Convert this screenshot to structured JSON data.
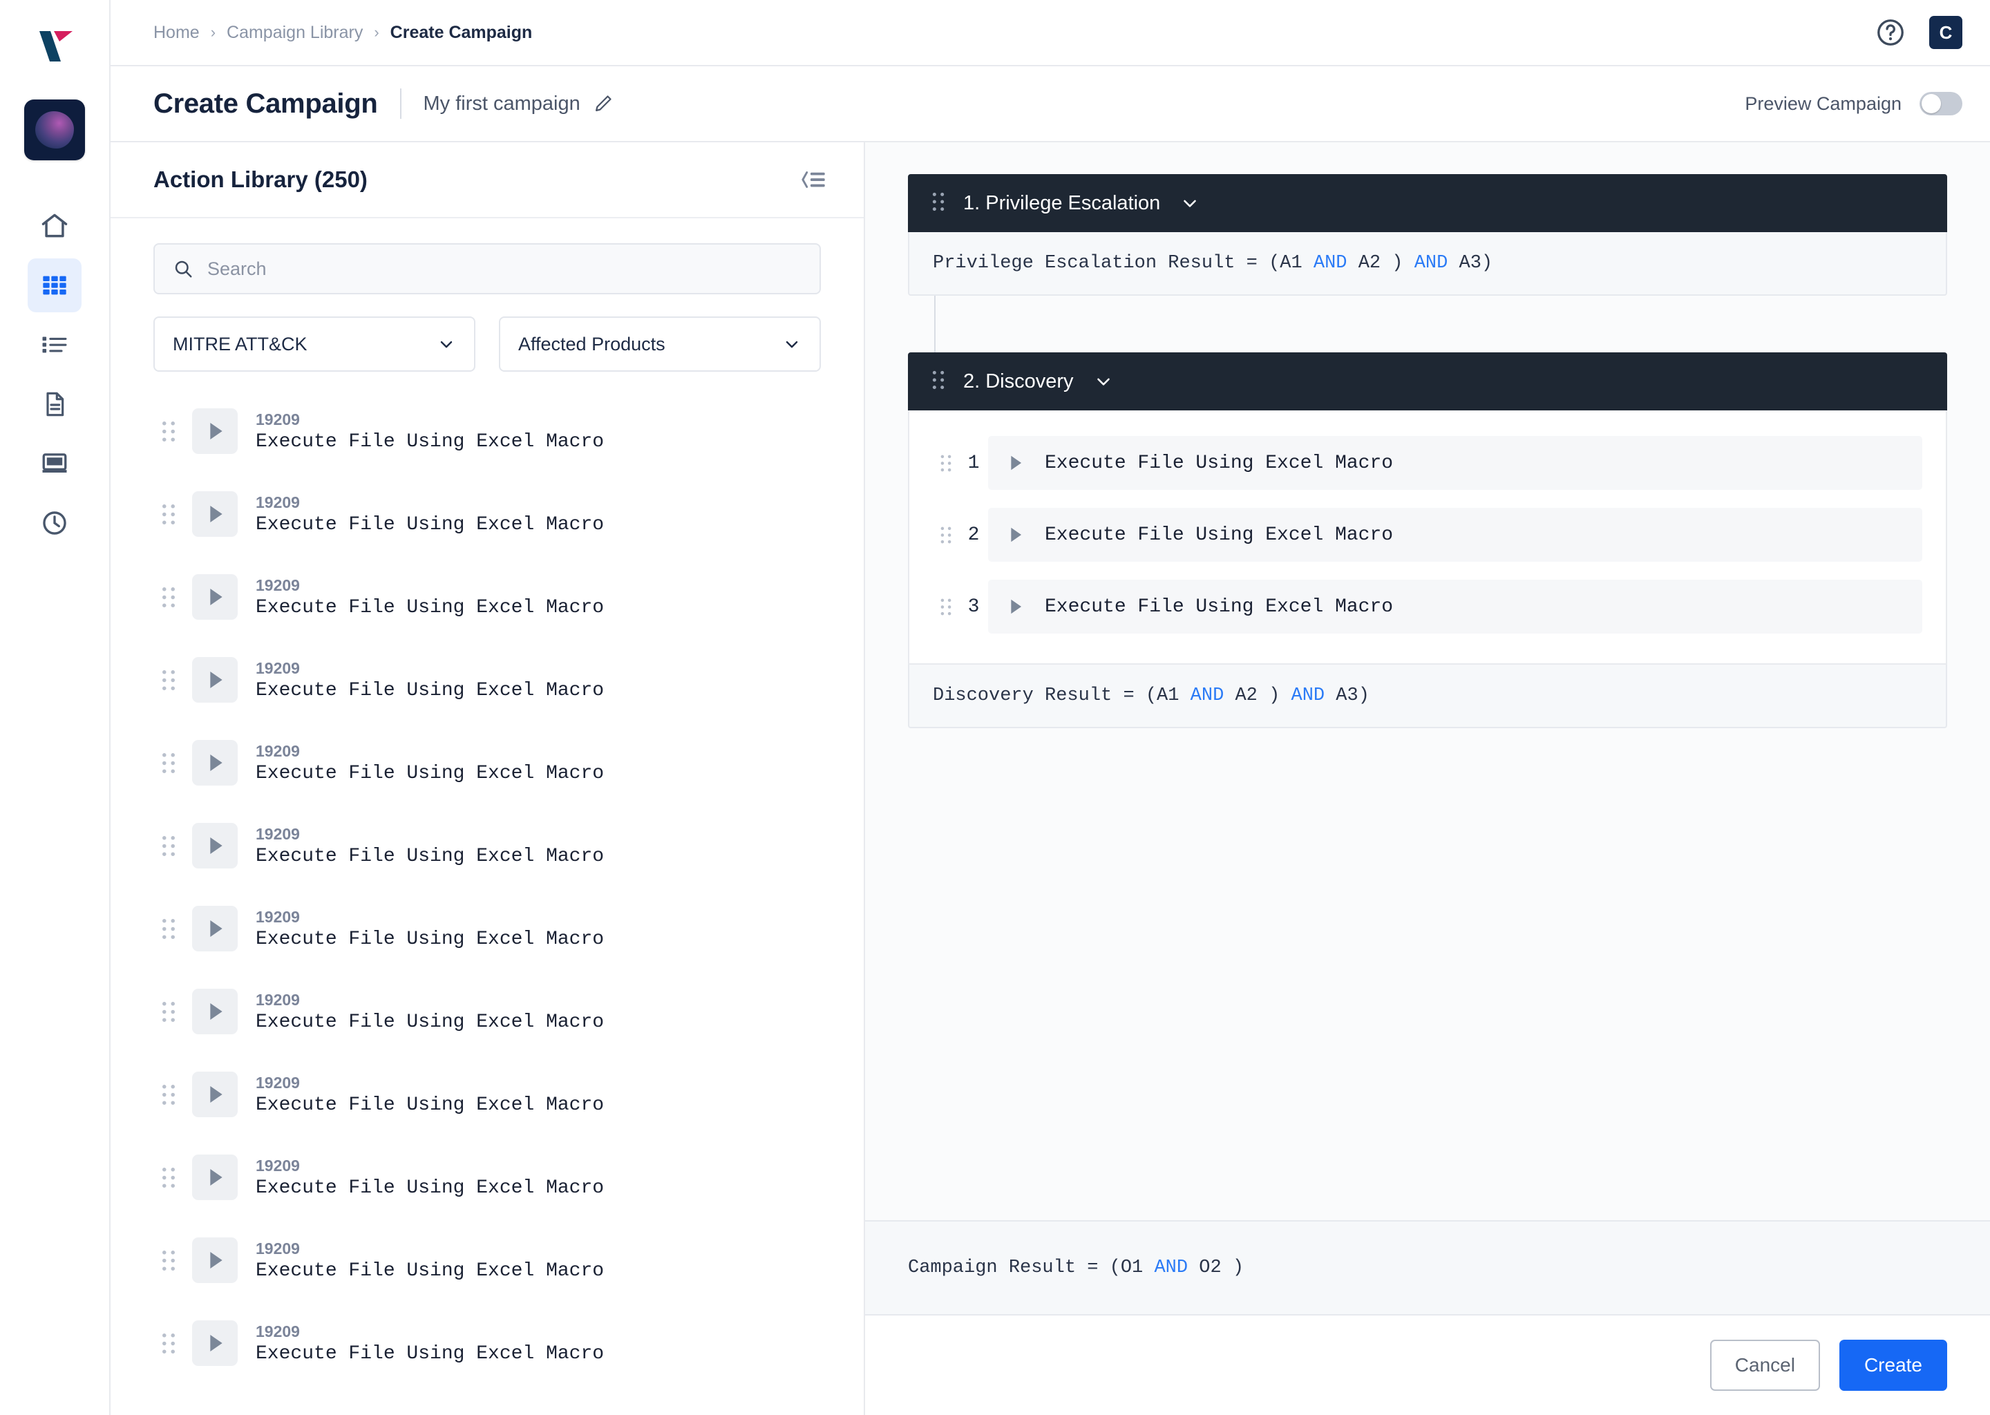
{
  "brand": {
    "logo_name": "valence-logo",
    "tile_icon": "orb-icon",
    "accent_blue": "#1668f5",
    "dark_navy": "#132a4e",
    "keyword_blue": "#2b7bf6",
    "phase_header_bg": "#1e2733"
  },
  "rail": {
    "items": [
      {
        "name": "home-icon",
        "label": "Home",
        "active": false
      },
      {
        "name": "grid-icon",
        "label": "Campaigns",
        "active": true
      },
      {
        "name": "list-icon",
        "label": "Actions",
        "active": false
      },
      {
        "name": "document-icon",
        "label": "Reports",
        "active": false
      },
      {
        "name": "monitor-icon",
        "label": "Agents",
        "active": false
      },
      {
        "name": "clock-icon",
        "label": "History",
        "active": false
      }
    ]
  },
  "breadcrumb": {
    "items": [
      {
        "label": "Home",
        "current": false
      },
      {
        "label": "Campaign Library",
        "current": false
      },
      {
        "label": "Create Campaign",
        "current": true
      }
    ],
    "separator": "›",
    "help_icon": "help-circle-icon",
    "avatar_initial": "C"
  },
  "title_bar": {
    "page_title": "Create Campaign",
    "campaign_name": "My first campaign",
    "edit_icon": "pencil-icon",
    "preview_label": "Preview Campaign",
    "preview_enabled": false
  },
  "library": {
    "heading": "Action Library (250)",
    "collapse_icon": "collapse-panel-icon",
    "search": {
      "value": "",
      "placeholder": "Search",
      "icon": "search-icon"
    },
    "filters": [
      {
        "label": "MITRE ATT&CK",
        "icon": "chevron-down-icon"
      },
      {
        "label": "Affected Products",
        "icon": "chevron-down-icon"
      }
    ],
    "items": [
      {
        "id": "19209",
        "name": "Execute File Using Excel Macro"
      },
      {
        "id": "19209",
        "name": "Execute File Using Excel Macro"
      },
      {
        "id": "19209",
        "name": "Execute File Using Excel Macro"
      },
      {
        "id": "19209",
        "name": "Execute File Using Excel Macro"
      },
      {
        "id": "19209",
        "name": "Execute File Using Excel Macro"
      },
      {
        "id": "19209",
        "name": "Execute File Using Excel Macro"
      },
      {
        "id": "19209",
        "name": "Execute File Using Excel Macro"
      },
      {
        "id": "19209",
        "name": "Execute File Using Excel Macro"
      },
      {
        "id": "19209",
        "name": "Execute File Using Excel Macro"
      },
      {
        "id": "19209",
        "name": "Execute File Using Excel Macro"
      },
      {
        "id": "19209",
        "name": "Execute File Using Excel Macro"
      },
      {
        "id": "19209",
        "name": "Execute File Using Excel Macro"
      }
    ]
  },
  "canvas": {
    "phases": [
      {
        "title": "1. Privilege Escalation",
        "collapsed": true,
        "steps": [],
        "result": {
          "prefix": "Privilege Escalation Result = (A1 ",
          "kw1": "AND",
          "mid": " A2 ) ",
          "kw2": "AND",
          "suffix": " A3)"
        }
      },
      {
        "title": "2. Discovery",
        "collapsed": false,
        "steps": [
          {
            "num": "1",
            "name": "Execute File Using Excel Macro"
          },
          {
            "num": "2",
            "name": "Execute File Using Excel Macro"
          },
          {
            "num": "3",
            "name": "Execute File Using Excel Macro"
          }
        ],
        "result": {
          "prefix": "Discovery Result = (A1 ",
          "kw1": "AND",
          "mid": " A2 ) ",
          "kw2": "AND",
          "suffix": " A3)"
        }
      }
    ],
    "campaign_result": {
      "prefix": "Campaign Result = (O1 ",
      "kw1": "AND",
      "suffix": " O2 )"
    },
    "footer": {
      "cancel_label": "Cancel",
      "create_label": "Create"
    }
  }
}
